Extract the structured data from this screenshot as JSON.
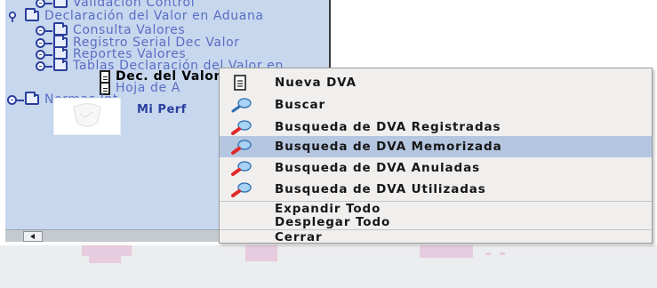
{
  "tree": {
    "items": [
      {
        "label": "Validacion Control"
      },
      {
        "label": "Declaración del Valor en Aduana"
      },
      {
        "label": "Consulta Valores"
      },
      {
        "label": "Registro Serial Dec Valor"
      },
      {
        "label": "Reportes Valores"
      },
      {
        "label": "Tablas Declaración del Valor en"
      },
      {
        "label": "Dec. del Valor en Aduana"
      },
      {
        "label": "Hoja de A"
      },
      {
        "label": "Normas Int"
      }
    ],
    "profile_label": "Mi Perf"
  },
  "context_menu": {
    "items": [
      {
        "label": "Nueva DVA",
        "icon": "document-icon"
      },
      {
        "label": "Buscar",
        "icon": "search-icon"
      },
      {
        "label": "Busqueda de DVA Registradas",
        "icon": "search-red-icon"
      },
      {
        "label": "Busqueda de DVA Memorizada",
        "icon": "search-red-icon",
        "highlighted": true
      },
      {
        "label": "Busqueda de DVA Anuladas",
        "icon": "search-red-icon"
      },
      {
        "label": "Busqueda de DVA Utilizadas",
        "icon": "search-red-icon"
      },
      {
        "label": "Expandir Todo"
      },
      {
        "label": "Desplegar Todo"
      },
      {
        "label": "Cerrar"
      }
    ]
  },
  "colors": {
    "tree_background": "#c7d7ee",
    "tree_text": "#5a6ec4",
    "menu_background": "#f0efee",
    "menu_highlight": "#b5c6e0"
  }
}
